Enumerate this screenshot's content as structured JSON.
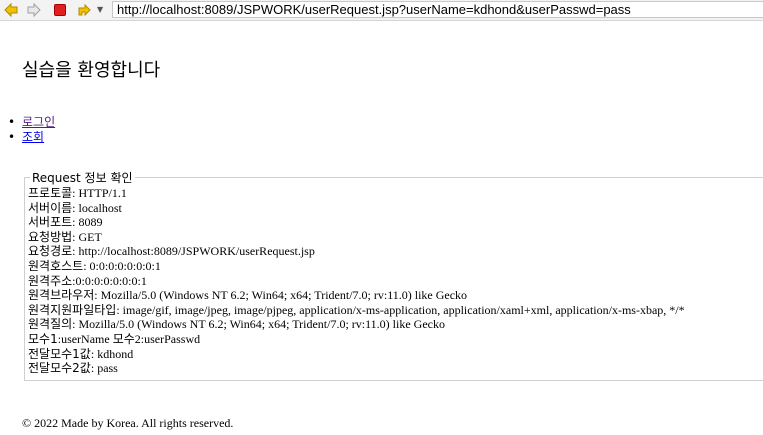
{
  "browser": {
    "url": "http://localhost:8089/JSPWORK/userRequest.jsp?userName=kdhond&userPasswd=pass",
    "back_icon": "back-arrow-icon",
    "forward_icon": "forward-arrow-icon",
    "stop_icon": "stop-icon",
    "go_icon": "go-icon"
  },
  "page": {
    "heading": "실습을 환영합니다",
    "menu": [
      {
        "label": "로그인"
      },
      {
        "label": "조회"
      }
    ],
    "info": {
      "legend": "Request 정보 확인",
      "rows": [
        {
          "key": "프로토콜",
          "value": "HTTP/1.1"
        },
        {
          "key": "서버이름",
          "value": "localhost"
        },
        {
          "key": "서버포트",
          "value": "8089"
        },
        {
          "key": "요청방법",
          "value": "GET"
        },
        {
          "key": "요청경로",
          "value": "http://localhost:8089/JSPWORK/userRequest.jsp"
        },
        {
          "key": "원격호스트",
          "value": "0:0:0:0:0:0:0:1"
        },
        {
          "key": "원격주소",
          "value": "0:0:0:0:0:0:0:1"
        },
        {
          "key": "원격브라우저",
          "value": "Mozilla/5.0 (Windows NT 6.2; Win64; x64; Trident/7.0; rv:11.0) like Gecko"
        },
        {
          "key": "원격지원파일타입",
          "value": "image/gif, image/jpeg, image/pjpeg, application/x-ms-application, application/xaml+xml, application/x-ms-xbap, */*"
        },
        {
          "key": "원격질의",
          "value": "Mozilla/5.0 (Windows NT 6.2; Win64; x64; Trident/7.0; rv:11.0) like Gecko"
        },
        {
          "key": "모수1",
          "value": "userName 모수2:userPasswd"
        },
        {
          "key": "전달모수1값",
          "value": "kdhond"
        },
        {
          "key": "전달모수2값",
          "value": "pass"
        }
      ]
    },
    "footer": "© 2022 Made by Korea. All rights reserved."
  },
  "colors": {
    "visited_link": "#551a8b",
    "link": "#0000ee",
    "stop_red": "#e02020",
    "arrow_yellow": "#f2c200"
  }
}
